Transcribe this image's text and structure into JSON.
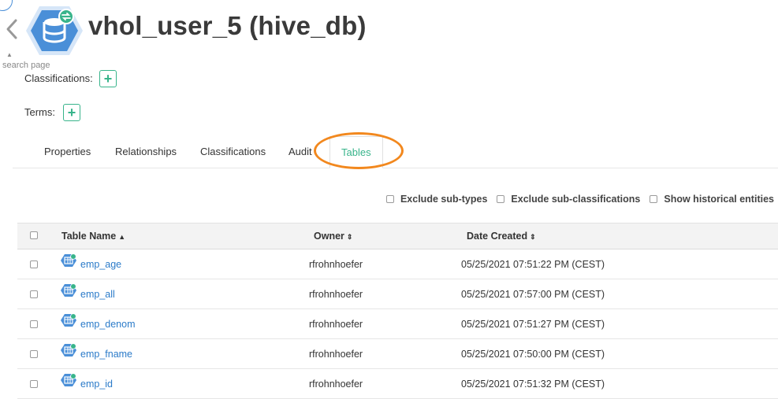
{
  "header": {
    "title": "vhol_user_5 (hive_db)",
    "search_page_label": "search page",
    "colors": {
      "badge": "#4a8fd8",
      "accent": "#38b48b",
      "highlight": "#f2881e"
    }
  },
  "classifications": {
    "label": "Classifications:",
    "add": "+"
  },
  "terms": {
    "label": "Terms:",
    "add": "+"
  },
  "tabs": [
    {
      "label": "Properties"
    },
    {
      "label": "Relationships"
    },
    {
      "label": "Classifications"
    },
    {
      "label": "Audit"
    },
    {
      "label": "Tables"
    }
  ],
  "filters": [
    {
      "label": "Exclude sub-types",
      "checked": false
    },
    {
      "label": "Exclude sub-classifications",
      "checked": false
    },
    {
      "label": "Show historical entities",
      "checked": false
    }
  ],
  "table": {
    "columns": [
      {
        "label": "Table Name",
        "sort": "▲"
      },
      {
        "label": "Owner",
        "sort": "⇕"
      },
      {
        "label": "Date Created",
        "sort": "⇕"
      }
    ],
    "rows": [
      {
        "name": "emp_age",
        "owner": "rfrohnhoefer",
        "date": "05/25/2021 07:51:22 PM (CEST)"
      },
      {
        "name": "emp_all",
        "owner": "rfrohnhoefer",
        "date": "05/25/2021 07:57:00 PM (CEST)"
      },
      {
        "name": "emp_denom",
        "owner": "rfrohnhoefer",
        "date": "05/25/2021 07:51:27 PM (CEST)"
      },
      {
        "name": "emp_fname",
        "owner": "rfrohnhoefer",
        "date": "05/25/2021 07:50:00 PM (CEST)"
      },
      {
        "name": "emp_id",
        "owner": "rfrohnhoefer",
        "date": "05/25/2021 07:51:32 PM (CEST)"
      }
    ]
  }
}
